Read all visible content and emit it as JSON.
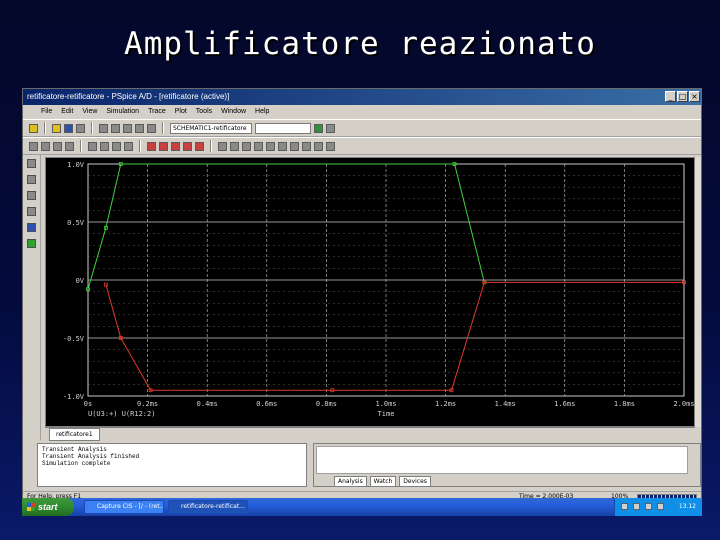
{
  "slide": {
    "title": "Amplificatore reazionato"
  },
  "window": {
    "title": "retificatore-retificatore - PSpice A/D - [retificatore (active)]",
    "menu": [
      "File",
      "Edit",
      "View",
      "Simulation",
      "Trace",
      "Plot",
      "Tools",
      "Window",
      "Help"
    ],
    "toolbar": {
      "profile_value": "SCHEMATIC1-retificatore",
      "second_combo_value": ""
    },
    "controls": {
      "minimize": "_",
      "maximize": "□",
      "close": "×"
    }
  },
  "plot": {
    "y_ticks": [
      "1.0V",
      "0.5V",
      "0V",
      "-0.5V",
      "-1.0V"
    ],
    "x_ticks": [
      "0s",
      "0.2ms",
      "0.4ms",
      "0.6ms",
      "0.8ms",
      "1.0ms",
      "1.2ms",
      "1.4ms",
      "1.6ms",
      "1.8ms",
      "2.0ms"
    ],
    "x_label": "Time",
    "legend": "U(U3:+)   U(R12:2)",
    "colors": {
      "series_green": "#3fd23f",
      "series_red": "#e03a2a",
      "axis": "#d0d0d0",
      "grid": "#c8c8c8",
      "background": "#000000"
    }
  },
  "chart_data": {
    "type": "line",
    "title": "",
    "xlabel": "Time",
    "ylabel": "",
    "x_unit": "ms",
    "xlim": [
      0,
      2.0
    ],
    "ylim": [
      -1.0,
      1.0
    ],
    "grid": true,
    "series": [
      {
        "name": "U(U3:+)",
        "color": "#3fd23f",
        "x": [
          0,
          0.06,
          0.11,
          1.23,
          1.33
        ],
        "y": [
          -0.08,
          0.45,
          1.0,
          1.0,
          -0.02
        ]
      },
      {
        "name": "U(R12:2)",
        "color": "#e03a2a",
        "x": [
          0.06,
          0.11,
          0.21,
          0.82,
          1.22,
          1.33,
          2.0
        ],
        "y": [
          -0.04,
          -0.5,
          -0.95,
          -0.95,
          -0.95,
          -0.02,
          -0.02
        ]
      }
    ]
  },
  "doc_tab": "retificatore1",
  "output_log": [
    "Transient Analysis",
    "Transient Analysis finished",
    "Simulation complete"
  ],
  "probe_tabs": [
    "Analysis",
    "Watch",
    "Devices"
  ],
  "status": {
    "help": "For Help, press F1",
    "time": "Time = 2.000E-03",
    "percent": "100%"
  },
  "taskbar": {
    "start": "start",
    "tasks": [
      "Capture CIS - [/ - (ret...",
      "retificatore-retificat..."
    ],
    "clock": "13.12"
  }
}
